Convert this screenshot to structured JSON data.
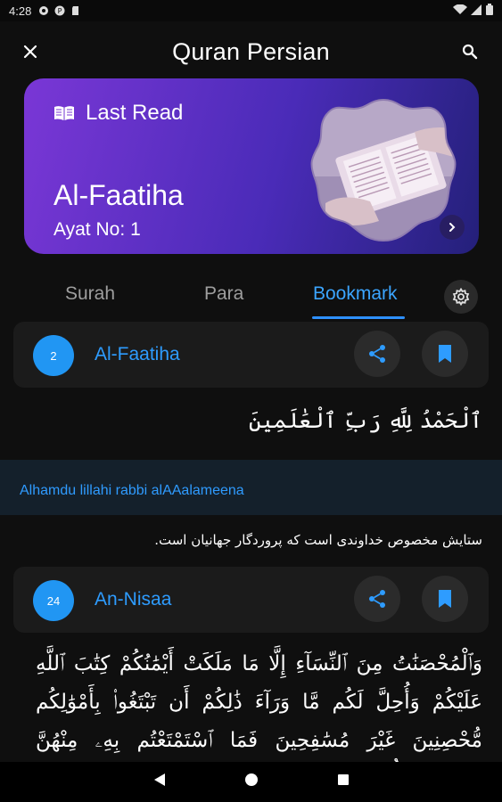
{
  "status_bar": {
    "time": "4:28"
  },
  "app_bar": {
    "title": "Quran Persian"
  },
  "last_read": {
    "label": "Last Read",
    "surah": "Al-Faatiha",
    "ayat_label": "Ayat No:",
    "ayat_number": "1"
  },
  "tabs": [
    {
      "label": "Surah",
      "active": false
    },
    {
      "label": "Para",
      "active": false
    },
    {
      "label": "Bookmark",
      "active": true
    }
  ],
  "bookmarks": [
    {
      "number": "2",
      "name": "Al-Faatiha",
      "arabic": "ٱلْحَمْدُ لِلَّهِ رَبِّ ٱلْعَٰلَمِينَ",
      "transliteration": "Alhamdu lillahi rabbi alAAalameena",
      "translation": "ستایش مخصوص خداوندی است که پروردگار جهانیان است."
    },
    {
      "number": "24",
      "name": "An-Nisaa",
      "arabic": "وَٱلْمُحْصَنَٰتُ مِنَ ٱلنِّسَآءِ إِلَّا مَا مَلَكَتْ أَيْمَٰنُكُمْ كِتَٰبَ ٱللَّهِ عَلَيْكُمْ وَأُحِلَّ لَكُم مَّا وَرَآءَ ذَٰلِكُمْ أَن تَبْتَغُوا۟ بِأَمْوَٰلِكُم مُّحْصِنِينَ غَيْرَ مُسَٰفِحِينَ فَمَا ٱسْتَمْتَعْتُم بِهِۦ مِنْهُنَّ فَـَٔاتُوهُنَّ أُجُورَهُنَّ فَرِيضَةً وَلَا جُنَاحَ عَلَيْكُمْ فِيمَا"
    }
  ],
  "colors": {
    "accent": "#2e9cff",
    "number_badge": "#2196f3",
    "card_gradient_start": "#7a37d6",
    "card_gradient_end": "#24207a",
    "background": "#0f0f0f"
  }
}
